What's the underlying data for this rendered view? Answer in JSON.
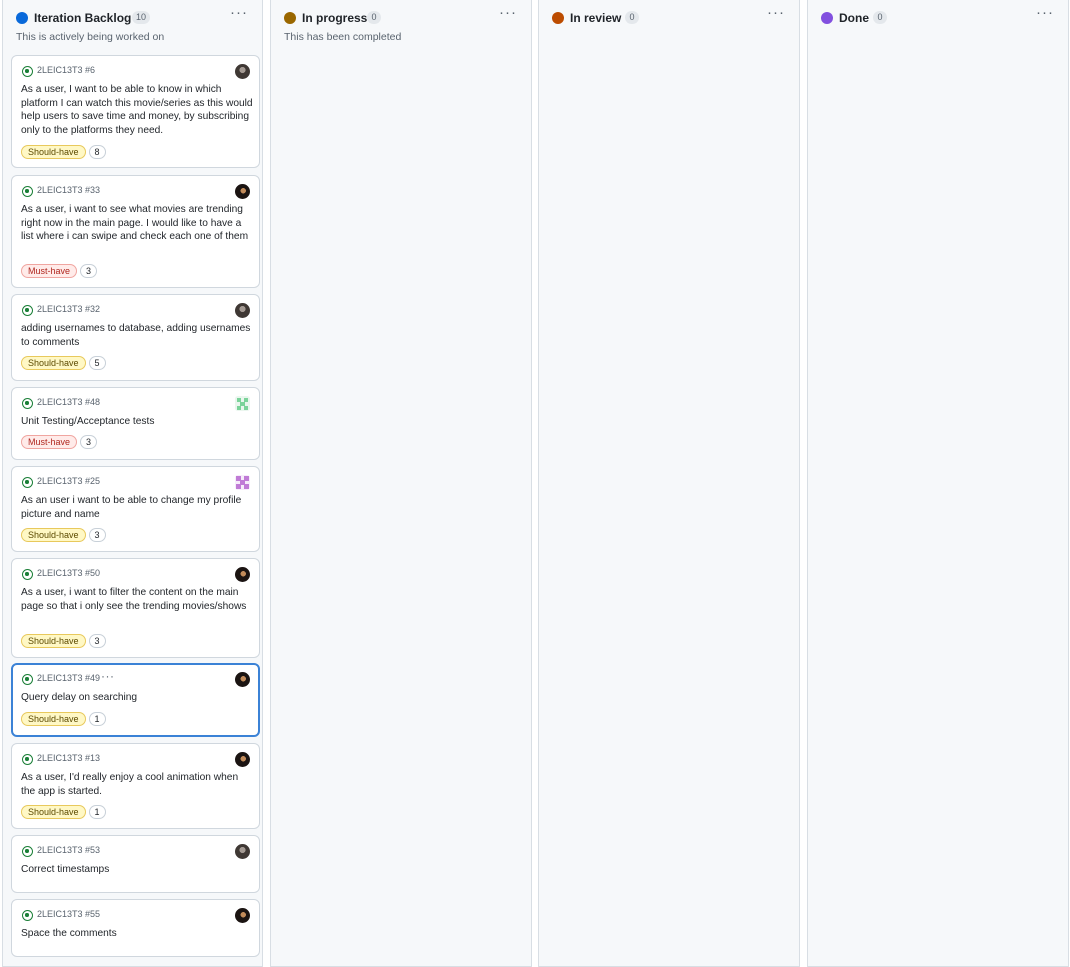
{
  "columns": [
    {
      "title": "Iteration Backlog",
      "count": "10",
      "description": "This is actively being worked on",
      "dot_color": "#0969da",
      "menu_icon": "kebab-horizontal-icon",
      "cards": [
        {
          "ref": "2LEIC13T3 #6",
          "title": "As a user, I want to be able to know in which platform I can watch this movie/series as this would help users to save time and money, by subscribing only to the platforms they need.",
          "label": "Should-have",
          "label_color": "#fff8c5",
          "estimate": "8",
          "avatar": "user-avatar"
        },
        {
          "ref": "2LEIC13T3 #33",
          "title": "As a user, i want to see what movies are trending right now in the main page. I would like to have a list where i can swipe and check each one of them",
          "label": "Must-have",
          "label_color": "#ffebe9",
          "estimate": "3",
          "avatar": "user-avatar"
        },
        {
          "ref": "2LEIC13T3 #32",
          "title": "adding usernames to database, adding usernames to comments",
          "label": "Should-have",
          "label_color": "#fff8c5",
          "estimate": "5",
          "avatar": "user-avatar"
        },
        {
          "ref": "2LEIC13T3 #48",
          "title": "Unit Testing/Acceptance tests",
          "label": "Must-have",
          "label_color": "#ffebe9",
          "estimate": "3",
          "avatar": "identicon-avatar"
        },
        {
          "ref": "2LEIC13T3 #25",
          "title": "As an user i want to be able to change my profile picture and name",
          "label": "Should-have",
          "label_color": "#fff8c5",
          "estimate": "3",
          "avatar": "identicon-avatar"
        },
        {
          "ref": "2LEIC13T3 #50",
          "title": "As a user, i want to filter the content on the main page so that i only see the trending movies/shows",
          "label": "Should-have",
          "label_color": "#fff8c5",
          "estimate": "3",
          "avatar": "user-avatar"
        },
        {
          "ref": "2LEIC13T3 #49",
          "title": "Query delay on searching",
          "label": "Should-have",
          "label_color": "#fff8c5",
          "estimate": "1",
          "avatar": "user-avatar",
          "selected": true,
          "menu": "···"
        },
        {
          "ref": "2LEIC13T3 #13",
          "title": "As a user, I'd really enjoy a cool animation when the app is started.",
          "label": "Should-have",
          "label_color": "#fff8c5",
          "estimate": "1",
          "avatar": "user-avatar"
        },
        {
          "ref": "2LEIC13T3 #53",
          "title": "Correct timestamps",
          "avatar": "user-avatar"
        },
        {
          "ref": "2LEIC13T3 #55",
          "title": "Space the comments",
          "avatar": "user-avatar"
        }
      ]
    },
    {
      "title": "In progress",
      "count": "0",
      "description": "This has been completed",
      "dot_color": "#9a6700",
      "menu_icon": "kebab-horizontal-icon",
      "cards": []
    },
    {
      "title": "In review",
      "count": "0",
      "description": "",
      "dot_color": "#bc4c00",
      "menu_icon": "kebab-horizontal-icon",
      "cards": []
    },
    {
      "title": "Done",
      "count": "0",
      "description": "",
      "dot_color": "#8250df",
      "menu_icon": "kebab-horizontal-icon",
      "cards": []
    }
  ],
  "ui": {
    "column_menu": "···"
  }
}
